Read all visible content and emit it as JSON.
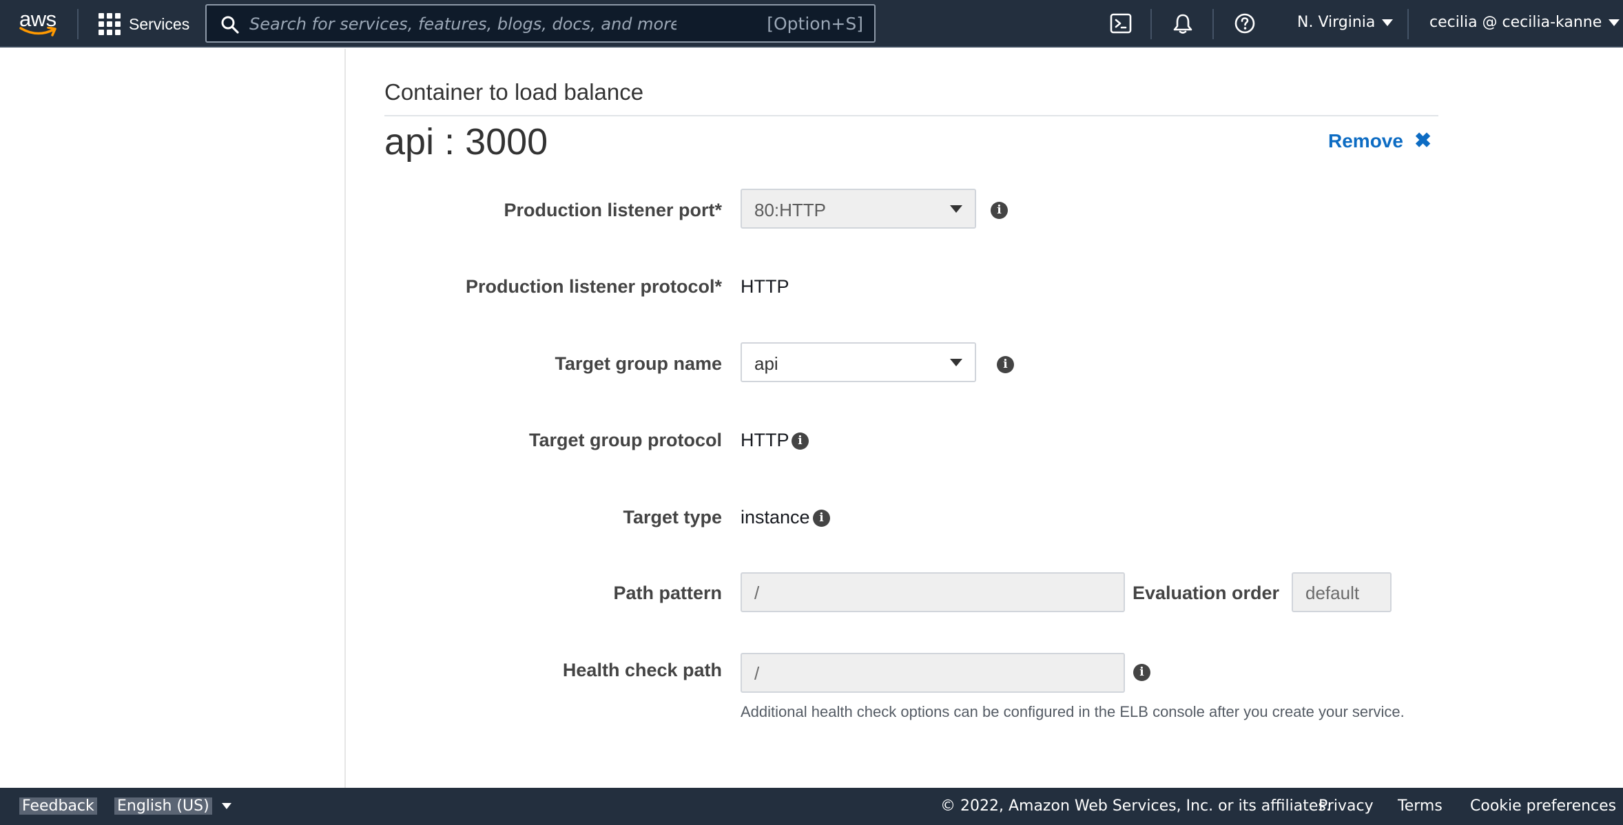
{
  "topnav": {
    "logo_text": "aws",
    "services_label": "Services",
    "search_placeholder": "Search for services, features, blogs, docs, and more",
    "search_shortcut": "[Option+S]",
    "region_label": "N. Virginia",
    "account_label": "cecilia @ cecilia-kanne",
    "icons": [
      "grid-icon",
      "search-icon",
      "cloudshell-icon",
      "bell-icon",
      "help-icon"
    ]
  },
  "main": {
    "section_heading": "Container to load balance",
    "container_title": "api : 3000",
    "remove_label": "Remove",
    "fields": {
      "prod_listener_port": {
        "label": "Production listener port*",
        "value": "80:HTTP"
      },
      "prod_listener_protocol": {
        "label": "Production listener protocol*",
        "value": "HTTP"
      },
      "target_group_name": {
        "label": "Target group name",
        "value": "api"
      },
      "target_group_protocol": {
        "label": "Target group protocol",
        "value": "HTTP"
      },
      "target_type": {
        "label": "Target type",
        "value": "instance"
      },
      "path_pattern": {
        "label": "Path pattern",
        "value": "/"
      },
      "evaluation_order": {
        "label": "Evaluation order",
        "value": "default"
      },
      "health_check_path": {
        "label": "Health check path",
        "value": "/"
      }
    },
    "health_check_help": "Additional health check options can be configured in the ELB console after you create your service."
  },
  "footer": {
    "feedback_label": "Feedback",
    "language_label": "English (US)",
    "copyright": "© 2022, Amazon Web Services, Inc. or its affiliates.",
    "privacy_label": "Privacy",
    "terms_label": "Terms",
    "cookie_label": "Cookie preferences"
  },
  "colors": {
    "nav_bg": "#232f3e",
    "link_blue": "#0d6cc3",
    "aws_orange": "#ff9900"
  }
}
